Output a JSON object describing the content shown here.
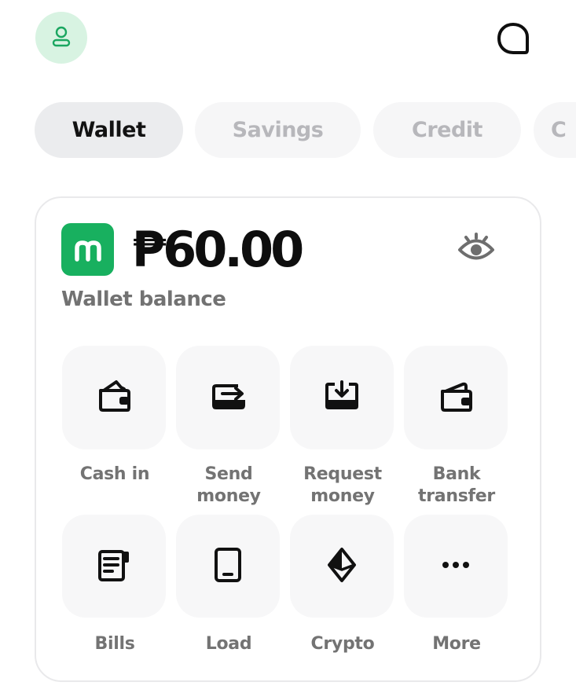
{
  "header": {
    "avatar_icon": "user-icon",
    "chat_icon": "chat-bubble-icon"
  },
  "tabs": [
    {
      "label": "Wallet",
      "active": true
    },
    {
      "label": "Savings",
      "active": false
    },
    {
      "label": "Credit",
      "active": false
    },
    {
      "label": "C",
      "active": false
    }
  ],
  "wallet": {
    "balance": "₱60.00",
    "label": "Wallet balance",
    "brand_mark": "m",
    "visibility_icon": "eye-icon"
  },
  "actions": [
    {
      "label": "Cash in",
      "icon": "wallet-cash-in-icon"
    },
    {
      "label": "Send\nmoney",
      "icon": "send-money-icon"
    },
    {
      "label": "Request\nmoney",
      "icon": "request-money-icon"
    },
    {
      "label": "Bank\ntransfer",
      "icon": "bank-transfer-icon"
    },
    {
      "label": "Bills",
      "icon": "bills-icon"
    },
    {
      "label": "Load",
      "icon": "mobile-load-icon"
    },
    {
      "label": "Crypto",
      "icon": "crypto-icon"
    },
    {
      "label": "More",
      "icon": "more-icon"
    }
  ],
  "colors": {
    "brand_green": "#18b05f",
    "avatar_bg": "#d8f3e2",
    "active_tab_bg": "#ebecee",
    "inactive_tab_text": "#b7b7bb",
    "label_gray": "#737373"
  }
}
